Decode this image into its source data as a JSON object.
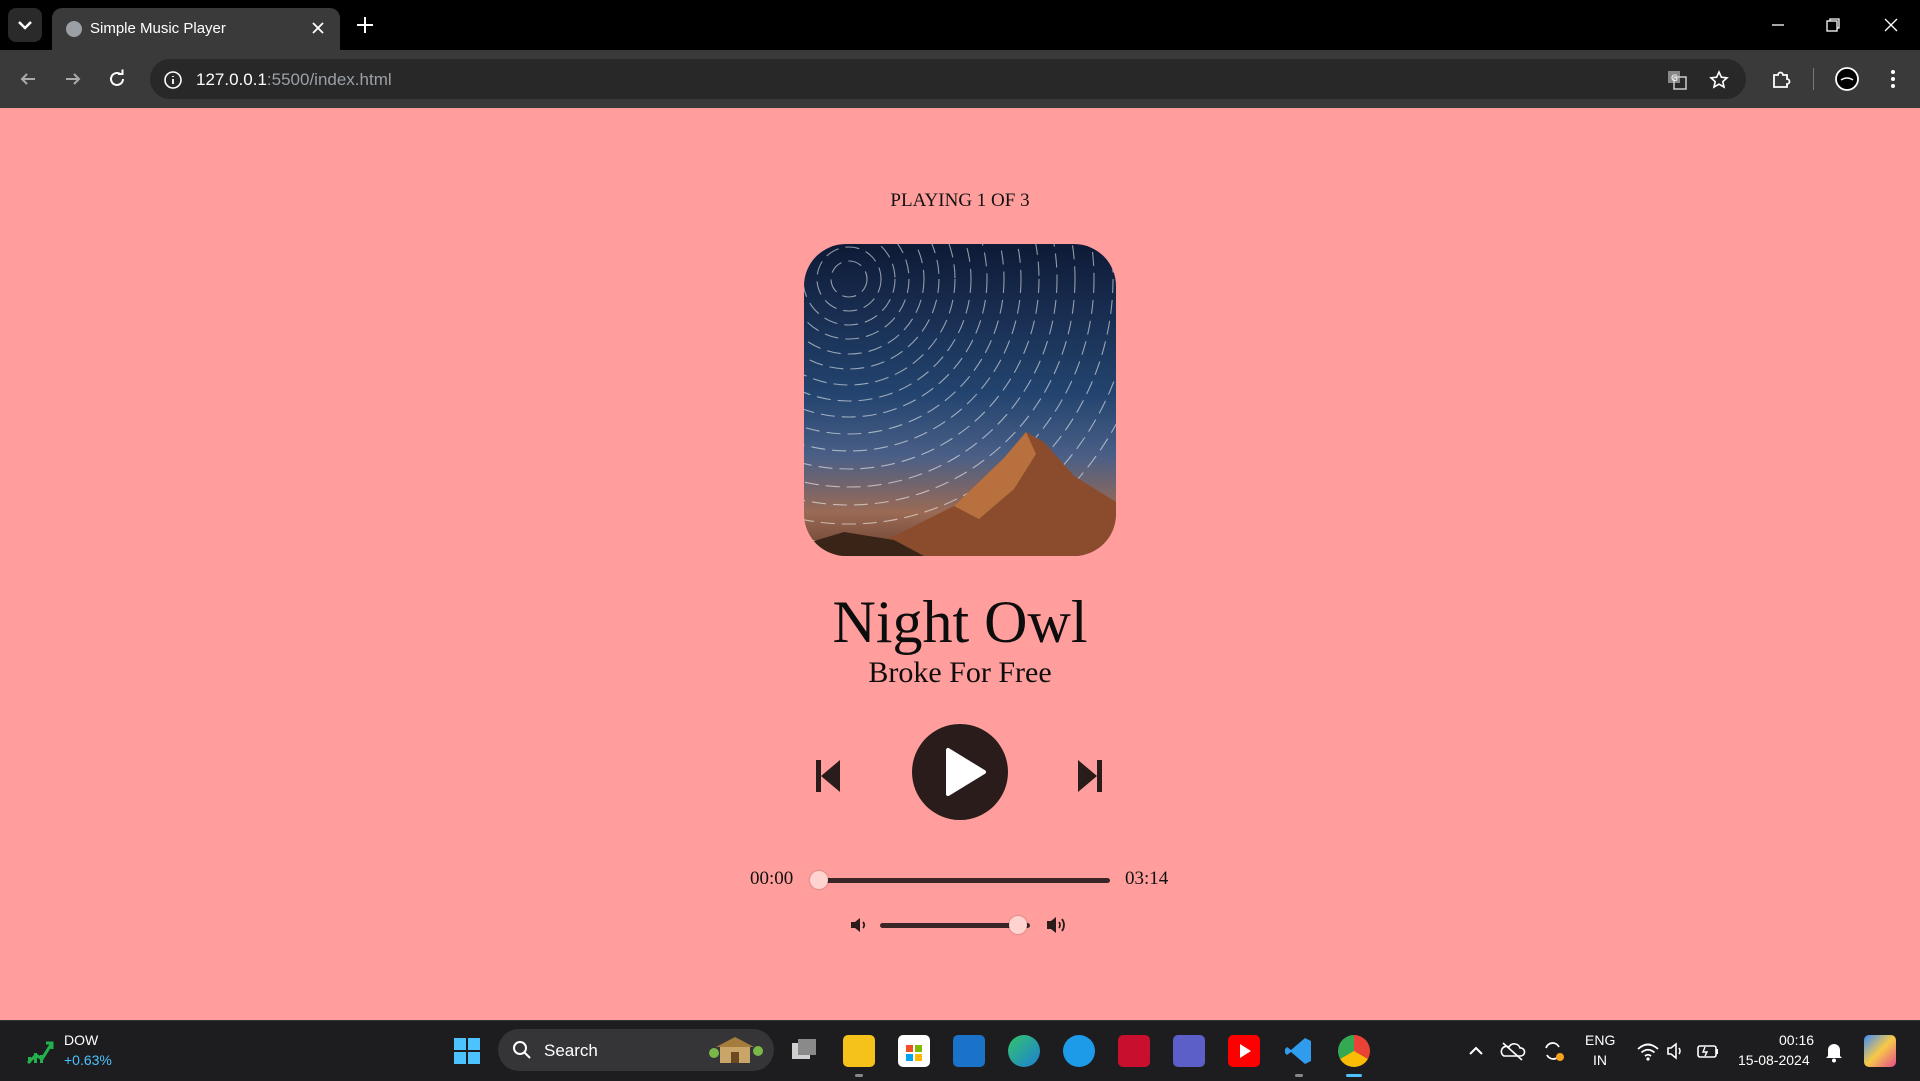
{
  "browser": {
    "tab_title": "Simple Music Player",
    "url_host": "127.0.0.1",
    "url_rest": ":5500/index.html"
  },
  "player": {
    "now_playing": "PLAYING 1 OF 3",
    "track_name": "Night Owl",
    "track_artist": "Broke For Free",
    "current_time": "00:00",
    "total_duration": "03:14",
    "seek_progress": 0,
    "volume_level": 0.92,
    "colors": {
      "background": "#ff9e9c",
      "button": "#2b1c1c",
      "slider_track": "#3a2626",
      "slider_thumb": "#ffd3d0"
    }
  },
  "taskbar": {
    "stock_name": "DOW",
    "stock_change": "+0.63%",
    "search_placeholder": "Search",
    "language": "ENG",
    "region": "IN",
    "time": "00:16",
    "date": "15-08-2024"
  }
}
